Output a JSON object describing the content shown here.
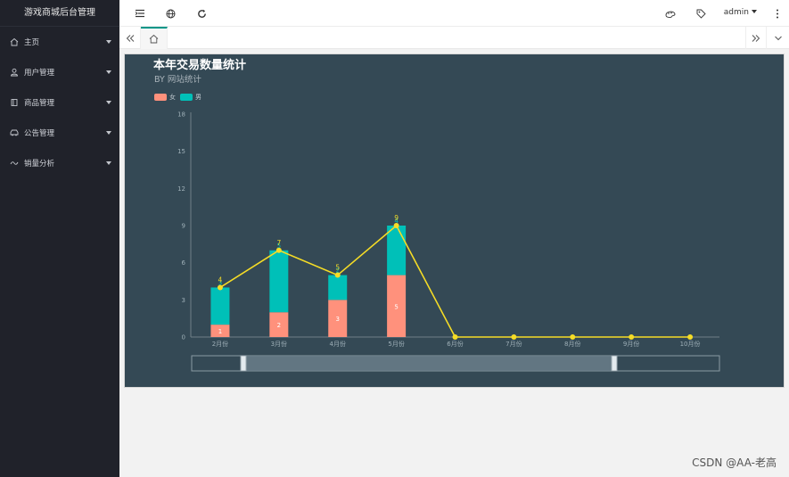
{
  "app": {
    "title": "游戏商城后台管理"
  },
  "sidebar": {
    "items": [
      {
        "label": "主页",
        "icon": "home-icon"
      },
      {
        "label": "用户管理",
        "icon": "user-icon"
      },
      {
        "label": "商品管理",
        "icon": "book-icon"
      },
      {
        "label": "公告管理",
        "icon": "car-icon"
      },
      {
        "label": "销量分析",
        "icon": "chart-icon"
      }
    ]
  },
  "header": {
    "user": "admin"
  },
  "chart_data": {
    "type": "bar",
    "title": "本年交易数量统计",
    "subtitle": "BY 网站统计",
    "categories": [
      "2月份",
      "3月份",
      "4月份",
      "5月份",
      "6月份",
      "7月份",
      "8月份",
      "9月份",
      "10月份"
    ],
    "series": [
      {
        "name": "女",
        "type": "bar",
        "stack": true,
        "color": "#ff917c",
        "values": [
          1,
          2,
          3,
          5,
          0,
          0,
          0,
          0,
          0
        ]
      },
      {
        "name": "男",
        "type": "bar",
        "stack": true,
        "color": "#00c0b8",
        "values": [
          3,
          5,
          2,
          4,
          0,
          0,
          0,
          0,
          0
        ]
      },
      {
        "type": "line",
        "color": "#f5dc26",
        "values": [
          4,
          7,
          5,
          9,
          0,
          0,
          0,
          0,
          0
        ]
      }
    ],
    "yticks": [
      0,
      3,
      6,
      9,
      12,
      15,
      18
    ],
    "ylim": [
      0,
      18
    ],
    "legend_position": "top-left",
    "line_labels": [
      "4",
      "7",
      "5",
      "9"
    ],
    "female_labels": [
      "1",
      "2",
      "3",
      "5"
    ],
    "male_labels": [
      "3",
      "5",
      "2",
      "4"
    ]
  },
  "watermark": "CSDN @AA-老高"
}
